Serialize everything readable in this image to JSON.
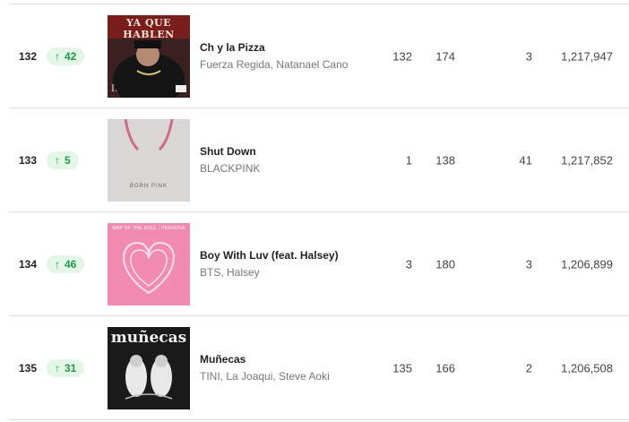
{
  "rows": [
    {
      "rank": "132",
      "change": "42",
      "title": "Ch y la Pizza",
      "artists": "Fuerza Regida, Natanael Cano",
      "peak": "132",
      "prev": "174",
      "streak": "3",
      "streams": "1,217,947",
      "cover_text": "YA QUE HABLEN",
      "cover_corner": "I."
    },
    {
      "rank": "133",
      "change": "5",
      "title": "Shut Down",
      "artists": "BLACKPINK",
      "peak": "1",
      "prev": "138",
      "streak": "41",
      "streams": "1,217,852",
      "cover_text": "BORN PINK"
    },
    {
      "rank": "134",
      "change": "46",
      "title": "Boy With Luv (feat. Halsey)",
      "artists": "BTS, Halsey",
      "peak": "3",
      "prev": "180",
      "streak": "3",
      "streams": "1,206,899",
      "cover_text": "MAP OF THE SOUL : PERSONA"
    },
    {
      "rank": "135",
      "change": "31",
      "title": "Muñecas",
      "artists": "TINI, La Joaqui, Steve Aoki",
      "peak": "135",
      "prev": "166",
      "streak": "2",
      "streams": "1,206,508",
      "cover_text": "muñecas"
    }
  ],
  "colors": {
    "accent_green": "#1f9a4a",
    "badge_bg": "#e4f6e8",
    "divider": "#dcdcdc"
  },
  "icons": {
    "change": "arrow-up-icon"
  }
}
